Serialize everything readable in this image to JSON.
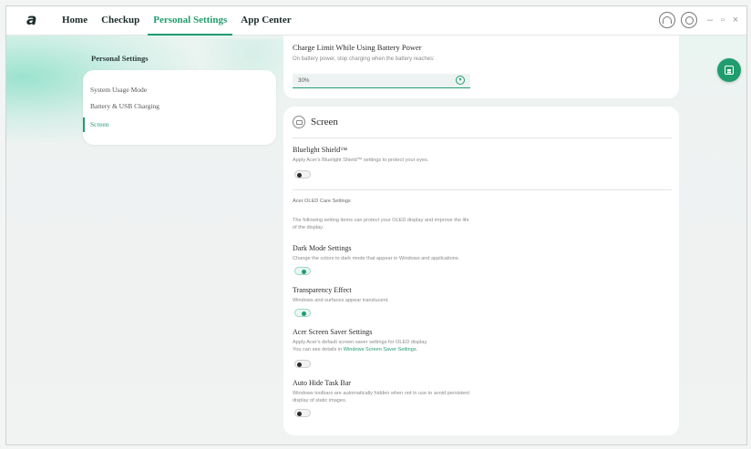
{
  "app": {
    "logo_glyph": "a",
    "nav": [
      {
        "label": "Home"
      },
      {
        "label": "Checkup"
      },
      {
        "label": "Personal Settings"
      },
      {
        "label": "App Center"
      }
    ],
    "active_nav": "Personal Settings",
    "window_controls": {
      "minimize": "–",
      "restore": "▫",
      "close": "×"
    },
    "icons": [
      "headset-icon",
      "settings-circle-icon"
    ]
  },
  "sidebar": {
    "title": "Personal Settings",
    "items": [
      {
        "label": "System Usage Mode"
      },
      {
        "label": "Battery & USB Charging"
      },
      {
        "label": "Screen"
      }
    ],
    "active_item": "Screen"
  },
  "battery_card": {
    "title": "Charge Limit While Using Battery Power",
    "description": "On battery power, stop charging when the battery reaches:",
    "select_value": "30%"
  },
  "screen_card": {
    "title": "Screen",
    "bluelight": {
      "title": "Bluelight Shield™",
      "description": "Apply Acer's Bluelight Shield™ settings to protect your eyes.",
      "enabled": false
    },
    "oled_section_label": "Acer OLED Care Settings",
    "oled_section_desc_1": "The following setting items can protect your OLED display and improve the life",
    "oled_section_desc_2": "of the display.",
    "dark_mode": {
      "title": "Dark Mode Settings",
      "description": "Change the colors to dark mode that appear in Windows and applications.",
      "enabled": true
    },
    "transparency": {
      "title": "Transparency Effect",
      "description": "Windows and surfaces appear translucent.",
      "enabled": true
    },
    "screen_saver": {
      "title": "Acer Screen Saver Settings",
      "description_1": "Apply Acer's default screen saver settings for OLED display.",
      "description_2_prefix": "You can see details in ",
      "description_2_link": "Windows Screen Saver Settings",
      "description_2_suffix": ".",
      "enabled": false
    },
    "auto_hide": {
      "title": "Auto Hide Task Bar",
      "description_1": "Windows toolbars are automatically hidden when not in use to avoid persistent",
      "description_2": "display of static images.",
      "enabled": false
    }
  },
  "colors": {
    "accent": "#1f9d6e",
    "background": "#f0f2f2",
    "card": "#ffffff"
  }
}
